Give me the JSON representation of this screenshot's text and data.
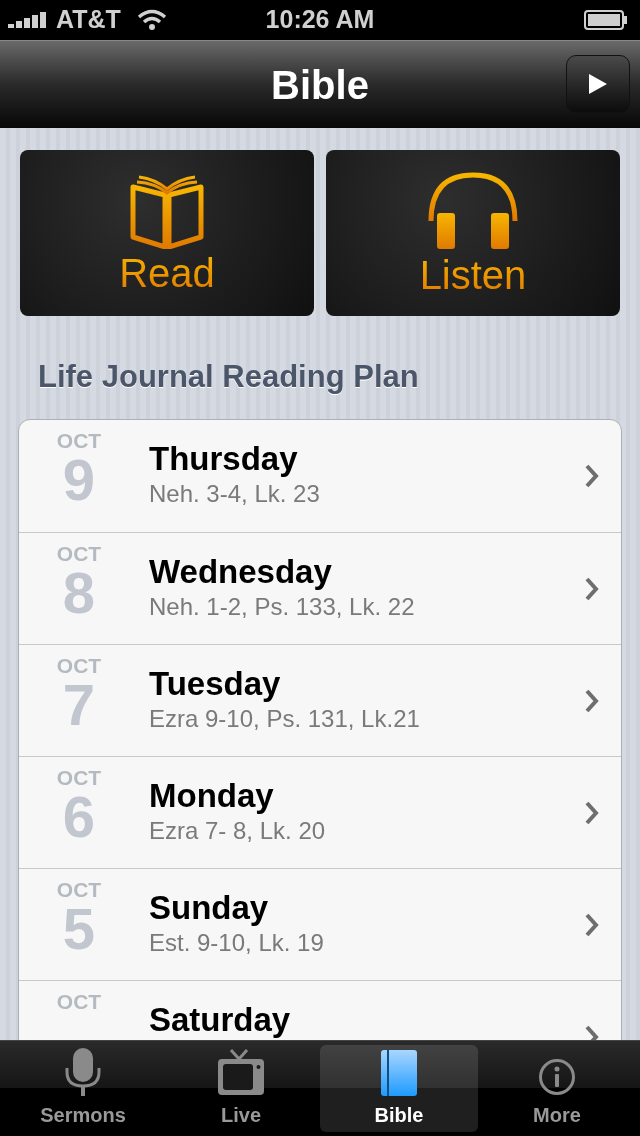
{
  "status_bar": {
    "carrier": "AT&T",
    "time": "10:26 AM"
  },
  "nav_bar": {
    "title": "Bible"
  },
  "tiles": [
    {
      "kind": "book",
      "label": "Read"
    },
    {
      "kind": "headphones",
      "label": "Listen"
    }
  ],
  "section_title": "Life Journal Reading Plan",
  "readings": [
    {
      "month": "OCT",
      "day": "9",
      "weekday": "Thursday",
      "passages": "Neh. 3-4, Lk. 23"
    },
    {
      "month": "OCT",
      "day": "8",
      "weekday": "Wednesday",
      "passages": "Neh. 1-2, Ps. 133, Lk. 22"
    },
    {
      "month": "OCT",
      "day": "7",
      "weekday": "Tuesday",
      "passages": "Ezra 9-10, Ps. 131, Lk.21"
    },
    {
      "month": "OCT",
      "day": "6",
      "weekday": "Monday",
      "passages": "Ezra 7- 8, Lk. 20"
    },
    {
      "month": "OCT",
      "day": "5",
      "weekday": "Sunday",
      "passages": "Est. 9-10, Lk. 19"
    },
    {
      "month": "OCT",
      "weekday": "Saturday"
    }
  ],
  "tab_bar": [
    {
      "kind": "mic",
      "label": "Sermons",
      "selected": false
    },
    {
      "kind": "tv",
      "label": "Live",
      "selected": false
    },
    {
      "kind": "bible",
      "label": "Bible",
      "selected": true
    },
    {
      "kind": "info",
      "label": "More",
      "selected": false
    }
  ]
}
